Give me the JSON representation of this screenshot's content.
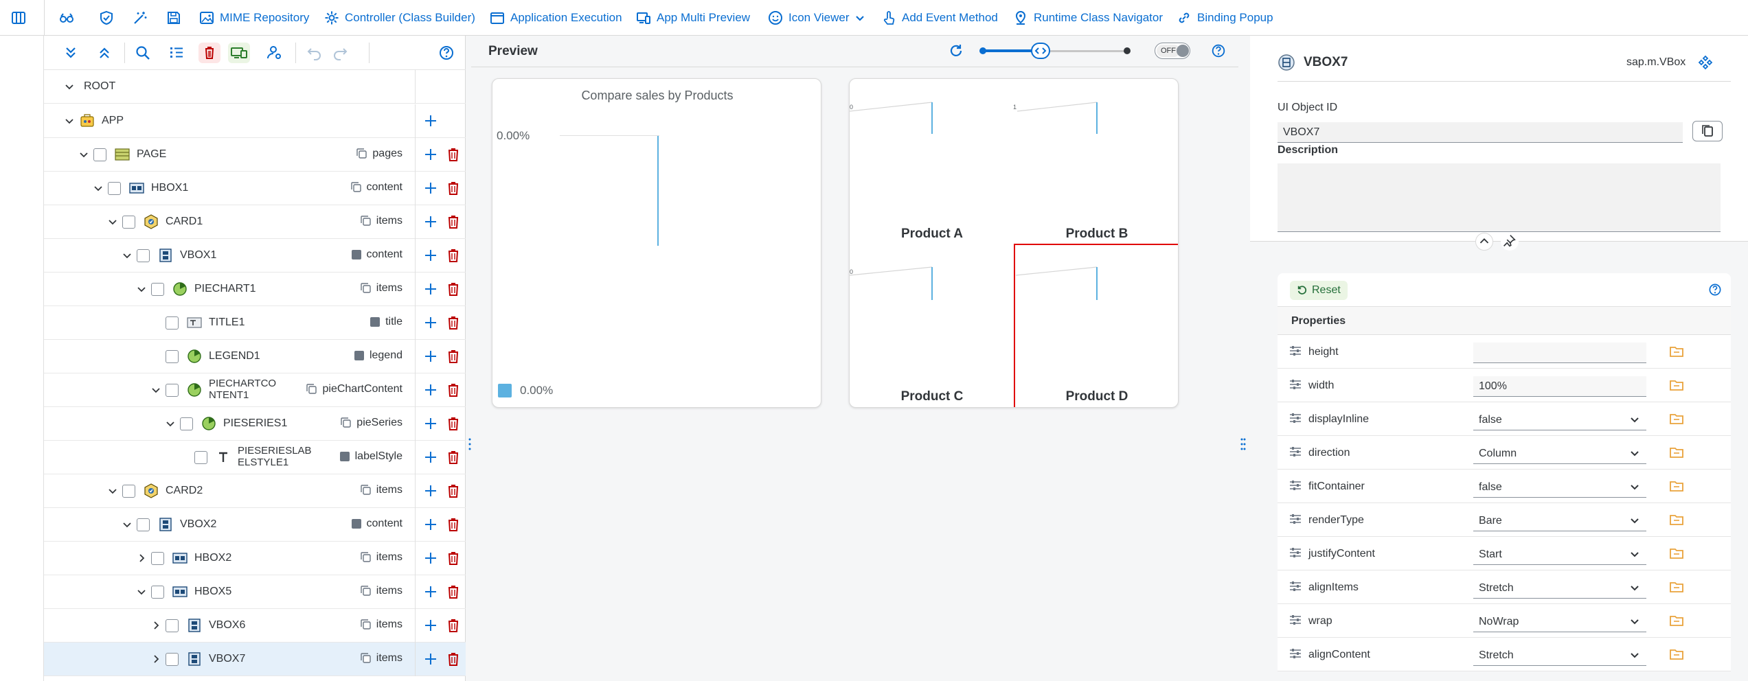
{
  "toolbar": {
    "items": [
      {
        "label": ""
      },
      {
        "label": ""
      },
      {
        "label": ""
      },
      {
        "label": ""
      },
      {
        "label": "MIME Repository"
      },
      {
        "label": "Controller (Class Builder)"
      },
      {
        "label": "Application Execution"
      },
      {
        "label": "App Multi Preview"
      },
      {
        "label": "Icon Viewer"
      },
      {
        "label": "Add Event Method"
      },
      {
        "label": "Runtime Class Navigator"
      },
      {
        "label": "Binding Popup"
      }
    ]
  },
  "tree": {
    "root_label": "ROOT",
    "nodes": [
      {
        "label": "APP",
        "aggregation": ""
      },
      {
        "label": "PAGE",
        "aggregation": "pages"
      },
      {
        "label": "HBOX1",
        "aggregation": "content"
      },
      {
        "label": "CARD1",
        "aggregation": "items"
      },
      {
        "label": "VBOX1",
        "aggregation": "content"
      },
      {
        "label": "PIECHART1",
        "aggregation": "items"
      },
      {
        "label": "TITLE1",
        "aggregation": "title"
      },
      {
        "label": "LEGEND1",
        "aggregation": "legend"
      },
      {
        "label": "PIECHARTCO\nNTENT1",
        "aggregation": "pieChartContent"
      },
      {
        "label": "PIESERIES1",
        "aggregation": "pieSeries"
      },
      {
        "label": "PIESERIESLAB\nELSTYLE1",
        "aggregation": "labelStyle"
      },
      {
        "label": "CARD2",
        "aggregation": "items"
      },
      {
        "label": "VBOX2",
        "aggregation": "content"
      },
      {
        "label": "HBOX2",
        "aggregation": "items"
      },
      {
        "label": "HBOX5",
        "aggregation": "items"
      },
      {
        "label": "VBOX6",
        "aggregation": "items"
      },
      {
        "label": "VBOX7",
        "aggregation": "items"
      }
    ]
  },
  "preview": {
    "title": "Preview",
    "toggle_label": "OFF",
    "slider_value": 0.4,
    "card1": {
      "chart_title": "Compare sales by Products",
      "value_label": "0.00%",
      "legend_label": "0.00%"
    },
    "card2": {
      "products": [
        "Product A",
        "Product B",
        "Product C",
        "Product D"
      ],
      "tick_labels": [
        "0",
        "1",
        "0"
      ]
    }
  },
  "properties": {
    "object_name": "VBOX7",
    "object_class": "sap.m.VBox",
    "ui_object_id_label": "UI Object ID",
    "ui_object_id": "VBOX7",
    "description_label": "Description",
    "description": "",
    "reset_label": "Reset",
    "section_title": "Properties",
    "rows": [
      {
        "name": "height",
        "value": "",
        "type": "input"
      },
      {
        "name": "width",
        "value": "100%",
        "type": "input"
      },
      {
        "name": "displayInline",
        "value": "false",
        "type": "select"
      },
      {
        "name": "direction",
        "value": "Column",
        "type": "select"
      },
      {
        "name": "fitContainer",
        "value": "false",
        "type": "select"
      },
      {
        "name": "renderType",
        "value": "Bare",
        "type": "select"
      },
      {
        "name": "justifyContent",
        "value": "Start",
        "type": "select"
      },
      {
        "name": "alignItems",
        "value": "Stretch",
        "type": "select"
      },
      {
        "name": "wrap",
        "value": "NoWrap",
        "type": "select"
      },
      {
        "name": "alignContent",
        "value": "Stretch",
        "type": "select"
      }
    ]
  },
  "colors": {
    "accent": "#0a6ed1",
    "delete": "#bb0000",
    "selection": "#e5f0fa",
    "highlight_border": "#e00000",
    "chart_line": "#5cb1e0"
  }
}
